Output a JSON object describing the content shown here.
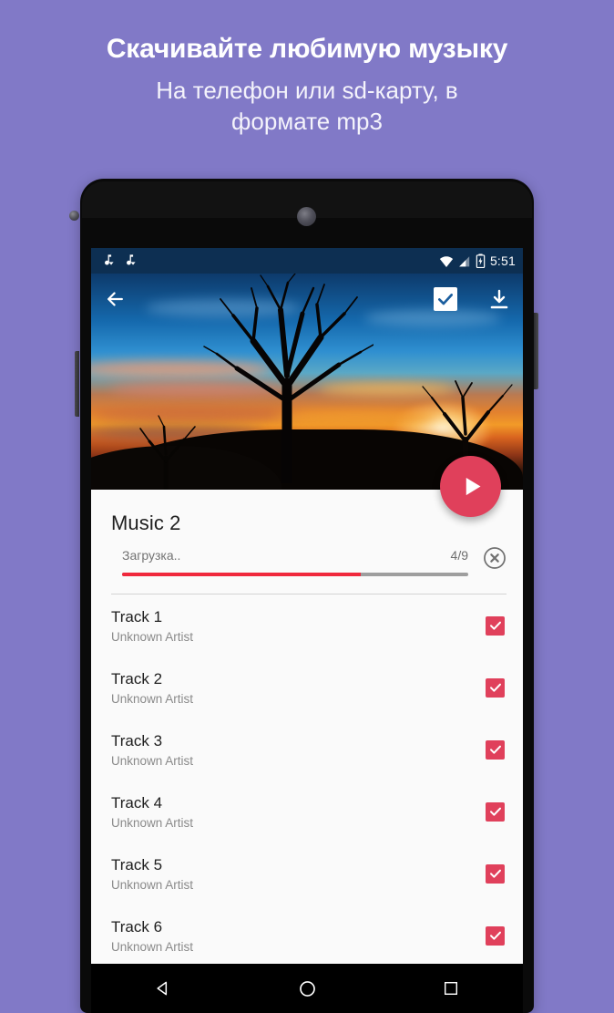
{
  "promo": {
    "title": "Скачивайте любимую музыку",
    "subtitle": "На телефон или sd-карту, в формате mp3",
    "background_color": "#8179C7"
  },
  "device": {
    "camera_icon": "front-camera",
    "speaker_icon": "earpiece-speaker",
    "volume_button": "volume-rocker",
    "power_button": "power-button"
  },
  "statusbar": {
    "background_color": "#0D2F52",
    "notifications": [
      {
        "icon": "music-download-icon"
      },
      {
        "icon": "music-download-icon"
      }
    ],
    "wifi_icon": "wifi-icon",
    "signal_icon": "cell-signal-icon",
    "battery_icon": "battery-charging-icon",
    "time": "5:51"
  },
  "appbar": {
    "back_icon": "back-arrow-icon",
    "select_all_icon": "checkbox-checked-icon",
    "download_icon": "download-icon"
  },
  "hero": {
    "description": "sunset-landscape-photo",
    "fab": {
      "icon": "play-icon",
      "color": "#E0405B"
    }
  },
  "album": {
    "title": "Music 2"
  },
  "download": {
    "status_label": "Загрузка..",
    "count": "4/9",
    "progress_percent": 69,
    "fill_color": "#F0283C",
    "track_color": "#9E9E9E",
    "cancel_icon": "cancel-circle-icon"
  },
  "tracks": [
    {
      "title": "Track 1",
      "artist": "Unknown Artist",
      "checked": true
    },
    {
      "title": "Track 2",
      "artist": "Unknown Artist",
      "checked": true
    },
    {
      "title": "Track 3",
      "artist": "Unknown Artist",
      "checked": true
    },
    {
      "title": "Track 4",
      "artist": "Unknown Artist",
      "checked": true
    },
    {
      "title": "Track 5",
      "artist": "Unknown Artist",
      "checked": true
    },
    {
      "title": "Track 6",
      "artist": "Unknown Artist",
      "checked": true
    }
  ],
  "checkbox_color": "#E0405B",
  "navbar": {
    "back_icon": "nav-back-triangle-icon",
    "home_icon": "nav-home-circle-icon",
    "recents_icon": "nav-recents-square-icon"
  }
}
